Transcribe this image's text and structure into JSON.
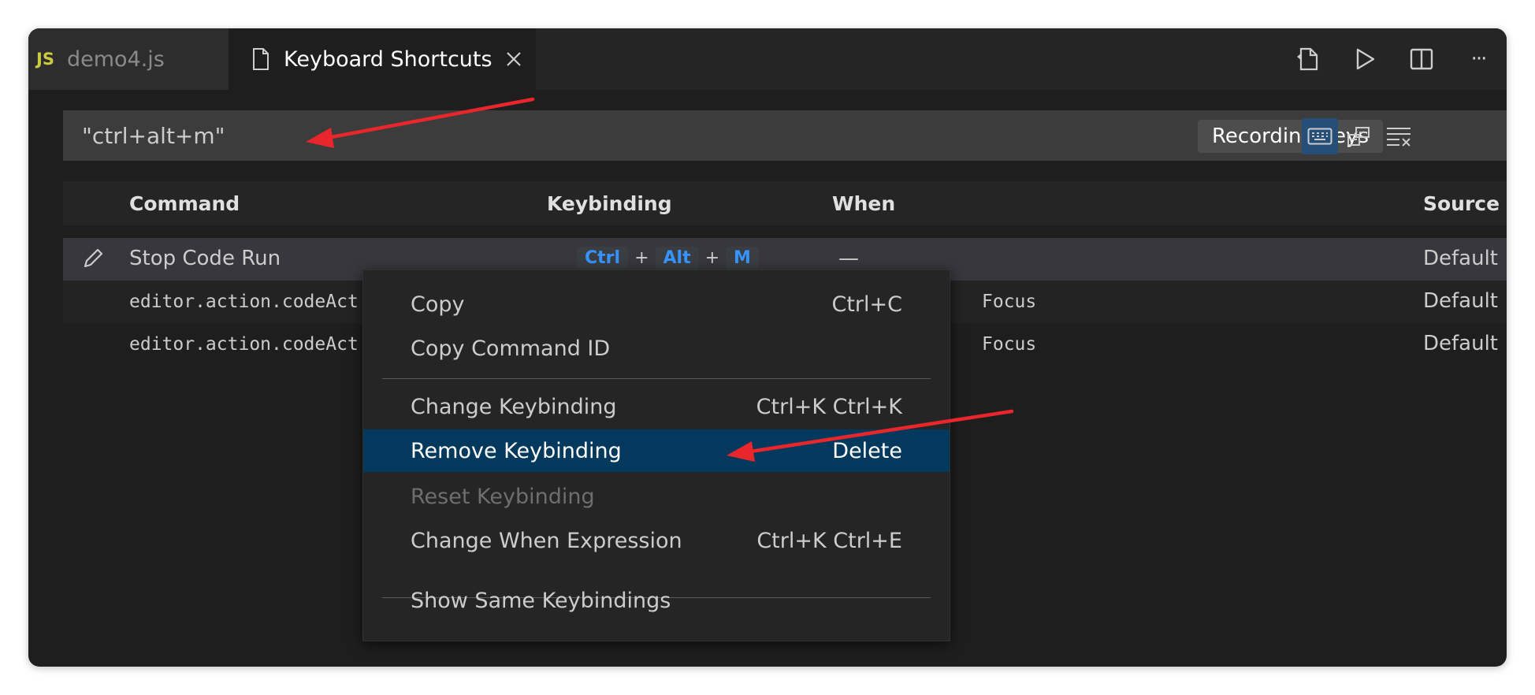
{
  "tabs": [
    {
      "badge": "JS",
      "label": "demo4.js",
      "active": false
    },
    {
      "label": "Keyboard Shortcuts",
      "active": true
    }
  ],
  "toolbar": {
    "icons": [
      "open-changes-icon",
      "run-icon",
      "split-editor-icon",
      "more-actions-icon"
    ],
    "more_label": "···"
  },
  "search": {
    "value": "\"ctrl+alt+m\"",
    "recording_label": "Recording Keys",
    "actions": [
      "record-keys-icon",
      "sort-by-precedence-icon",
      "clear-input-icon"
    ]
  },
  "table": {
    "headers": {
      "command": "Command",
      "keybinding": "Keybinding",
      "when": "When",
      "source": "Source"
    },
    "rows": [
      {
        "command": "Stop Code Run",
        "keys": [
          "Ctrl",
          "Alt",
          "M"
        ],
        "plus": "+",
        "when": "—",
        "source": "Default"
      },
      {
        "command": "editor.action.codeAct",
        "when": "Focus",
        "source": "Default"
      },
      {
        "command": "editor.action.codeAct",
        "when": "Focus",
        "source": "Default"
      }
    ]
  },
  "context_menu": {
    "items": [
      {
        "label": "Copy",
        "shortcut": "Ctrl+C"
      },
      {
        "label": "Copy Command ID",
        "shortcut": ""
      },
      {
        "label": "Change Keybinding",
        "shortcut": "Ctrl+K Ctrl+K"
      },
      {
        "label": "Remove Keybinding",
        "shortcut": "Delete"
      },
      {
        "label": "Reset Keybinding",
        "shortcut": ""
      },
      {
        "label": "Change When Expression",
        "shortcut": "Ctrl+K Ctrl+E"
      },
      {
        "label": "Show Same Keybindings",
        "shortcut": ""
      }
    ]
  },
  "colors": {
    "background": "#1e1e1e",
    "tab_bar": "#252526",
    "menu_highlight": "#04395e",
    "keybinding_text": "#3794ff",
    "js_badge": "#cbcb41",
    "annotation_arrow": "#e8262b"
  }
}
